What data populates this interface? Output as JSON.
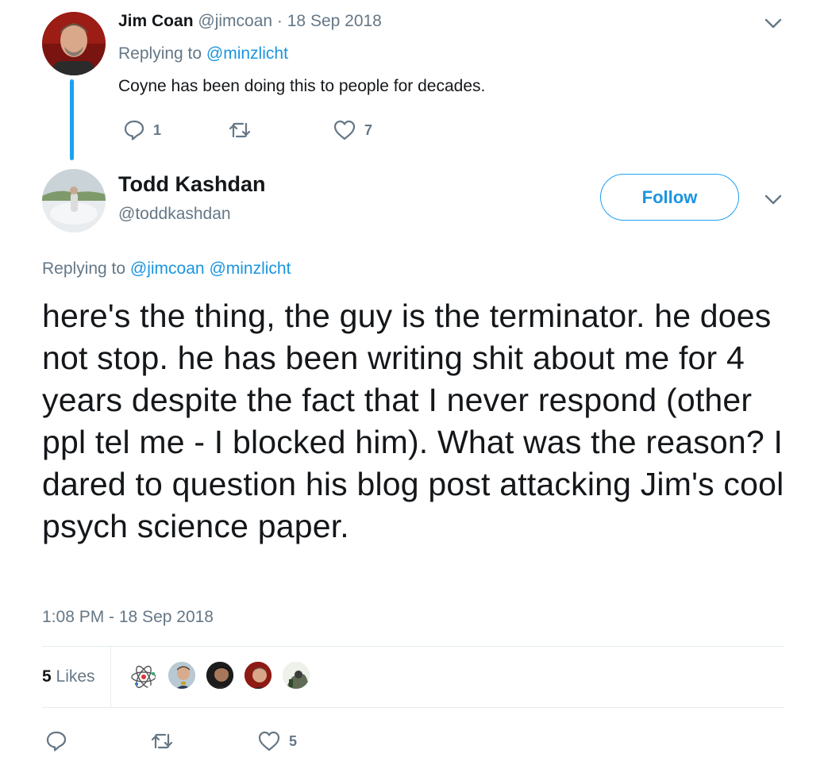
{
  "reply_tweet": {
    "display_name": "Jim Coan",
    "handle": "@jimcoan",
    "separator": "·",
    "date": "18 Sep 2018",
    "replying_prefix": "Replying to",
    "replying_to": "@minzlicht",
    "text": "Coyne has been doing this to people for decades.",
    "reply_count": "1",
    "retweet_count": "",
    "like_count": "7"
  },
  "main_tweet": {
    "display_name": "Todd Kashdan",
    "handle": "@toddkashdan",
    "follow_label": "Follow",
    "replying_prefix": "Replying to",
    "replying_to": [
      "@jimcoan",
      "@minzlicht"
    ],
    "text": "here's the thing, the guy is the terminator. he does not stop. he has been writing shit about me for 4 years despite the fact that I never respond (other ppl tel me - I blocked him). What was the reason? I dared to question his blog post attacking Jim's cool psych science paper.",
    "timestamp": "1:08 PM - 18 Sep 2018",
    "likes_count": "5",
    "likes_label": "Likes",
    "like_count": "5"
  },
  "colors": {
    "accent": "#1da1f2",
    "link": "#1b95e0",
    "muted": "#657786",
    "text": "#14171a",
    "divider": "#e6ecf0"
  },
  "icons": {
    "reply": "reply-icon",
    "retweet": "retweet-icon",
    "like": "heart-icon",
    "more": "chevron-down-icon"
  }
}
